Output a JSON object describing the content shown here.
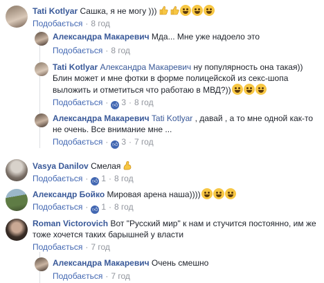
{
  "labels": {
    "reply": "Подобається",
    "separator": "·"
  },
  "comments": [
    {
      "author": "Tati Kotlyar",
      "text": "Сашка, я не могу )))",
      "time": "8 год"
    },
    {
      "author": "Александра Макаревич",
      "text": "Мда... Мне уже надоело это",
      "time": "8 год"
    },
    {
      "author": "Tati Kotlyar",
      "mention": "Александра Макаревич",
      "text_line1": " ну популярность она такая))",
      "text_line2": "Блин может и мне фотки в форме полицейской из секс-шопа",
      "text_line3": "выложить и отметиться что работаю в МВД?))",
      "likes": "3",
      "time": "8 год"
    },
    {
      "author": "Александра Макаревич",
      "mention": "Tati Kotlyar",
      "text_line1": " , давай , а то мне одной как-то",
      "text_line2": "не очень. Все внимание мне ...",
      "likes": "3",
      "time": "7 год"
    },
    {
      "author": "Vasya Danilov",
      "text": "Смелая",
      "likes": "1",
      "time": "8 год"
    },
    {
      "author": "Александр Бойко",
      "text": "Мировая арена наша))))",
      "likes": "1",
      "time": "8 год"
    },
    {
      "author": "Roman Victorovich",
      "text_line1": "Вот \"Русский мир\" к нам и стучится постоянно, им же",
      "text_line2": "тоже хочется таких барышней у власти",
      "time": "7 год"
    },
    {
      "author": "Александра Макаревич",
      "text": "Очень смешно",
      "time": "7 год"
    }
  ]
}
